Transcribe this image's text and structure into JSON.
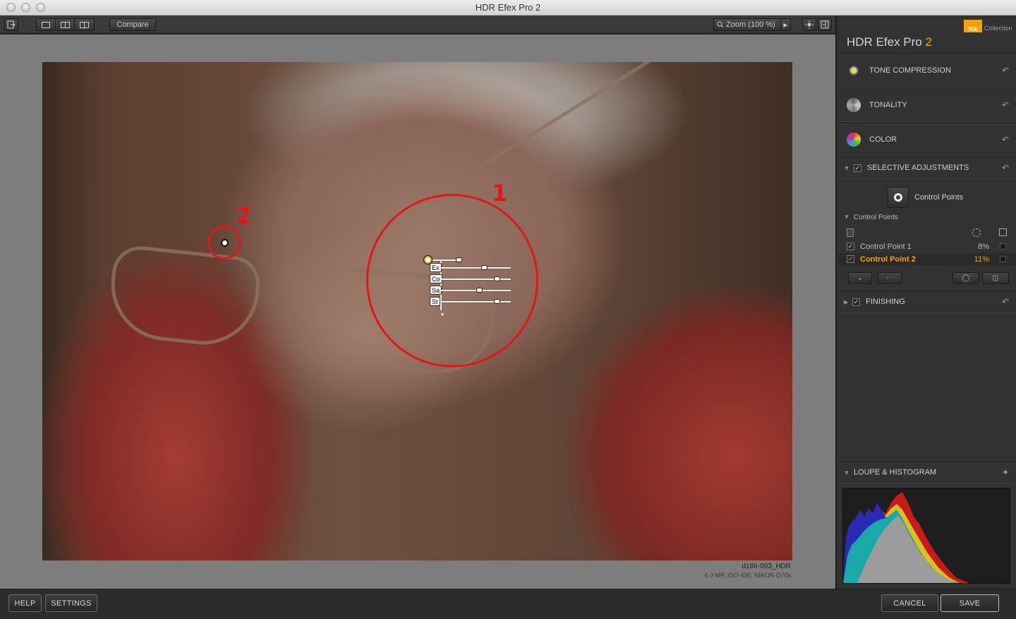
{
  "window": {
    "title": "HDR Efex Pro 2"
  },
  "toolbar": {
    "compare_label": "Compare",
    "zoom_label": "Zoom (100 %)"
  },
  "image": {
    "filename": "d186-093_HDR",
    "info": "6.0 MP, ISO 400, NIKON D70s"
  },
  "annotations": {
    "label_1": "1",
    "label_2": "2",
    "annotation_color": "#e01818"
  },
  "control_point_sliders": [
    {
      "label": "Ex",
      "value": 0.62
    },
    {
      "label": "Co",
      "value": 0.8
    },
    {
      "label": "Sa",
      "value": 0.55
    },
    {
      "label": "St",
      "value": 0.8
    }
  ],
  "panel": {
    "brand_logo": "Nik",
    "brand_collection": "Collection",
    "title_main": "HDR Efex Pro ",
    "title_version": "2",
    "accent_color": "#f2a20c",
    "sections": {
      "tone_compression": "TONE COMPRESSION",
      "tonality": "TONALITY",
      "color": "COLOR",
      "selective_adjustments": "SELECTIVE ADJUSTMENTS",
      "finishing": "FINISHING",
      "loupe_histogram": "LOUPE & HISTOGRAM"
    },
    "control_points_button": "Control Points",
    "control_points_header": "Control Points",
    "control_points": [
      {
        "name": "Control Point 1",
        "value": "8%",
        "selected": false
      },
      {
        "name": "Control Point 2",
        "value": "11%",
        "selected": true
      }
    ]
  },
  "footer": {
    "help": "HELP",
    "settings": "SETTINGS",
    "cancel": "CANCEL",
    "save": "SAVE"
  }
}
